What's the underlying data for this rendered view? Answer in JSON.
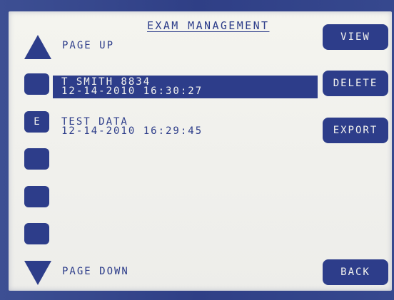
{
  "screen": {
    "title": "EXAM MANAGEMENT",
    "page_up_label": "PAGE UP",
    "page_down_label": "PAGE DOWN"
  },
  "records": [
    {
      "name": "T SMITH 8834",
      "datetime": "12-14-2010 16:30:27",
      "selected": true
    },
    {
      "name": "TEST DATA",
      "datetime": "12-14-2010 16:29:45",
      "selected": false
    }
  ],
  "left_buttons": [
    {
      "label": ""
    },
    {
      "label": "E"
    },
    {
      "label": ""
    },
    {
      "label": ""
    },
    {
      "label": ""
    }
  ],
  "right_buttons": {
    "view": "VIEW",
    "delete": "DELETE",
    "export": "EXPORT",
    "back": "BACK"
  },
  "colors": {
    "ink": "#2d3d8a",
    "background": "#f2f2ee",
    "bezel": "#34458c"
  }
}
